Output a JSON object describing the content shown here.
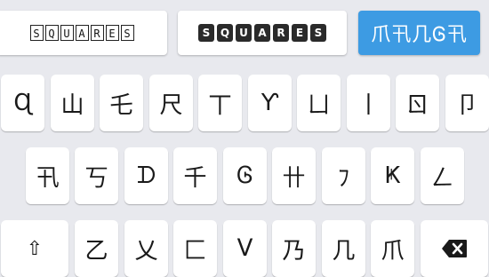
{
  "font_styles": [
    {
      "name": "squares-outline",
      "letters": [
        "S",
        "Q",
        "U",
        "A",
        "R",
        "E",
        "S"
      ]
    },
    {
      "name": "squares-filled",
      "letters": [
        "S",
        "Q",
        "U",
        "A",
        "R",
        "E",
        "S"
      ]
    },
    {
      "name": "active-style",
      "label": "爪卂几Ꮆ卂",
      "selected": true
    }
  ],
  "keyboard": {
    "row1": [
      "Ɋ",
      "山",
      "乇",
      "尺",
      "丅",
      "Ƴ",
      "ㄩ",
      "丨",
      "ㄖ",
      "卩"
    ],
    "row2": [
      "卂",
      "丂",
      "ᗪ",
      "千",
      "Ꮆ",
      "卄",
      "ﾌ",
      "Ҝ",
      "ㄥ"
    ],
    "row3": [
      "乙",
      "乂",
      "匚",
      "ᐯ",
      "乃",
      "几",
      "爪"
    ],
    "shift_label": "⇧",
    "delete_label": "⌫"
  },
  "colors": {
    "accent": "#3d9be3",
    "background": "#e8e9ee",
    "key": "#ffffff"
  }
}
